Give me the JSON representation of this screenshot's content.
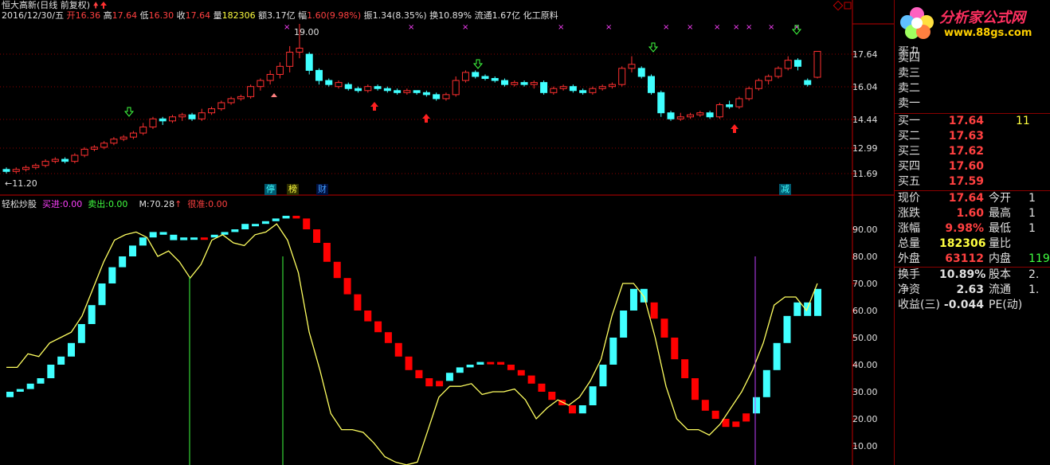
{
  "header": {
    "title": "恒大高新(日线 前复权)",
    "date": "2016/12/30/五",
    "open_label": "开",
    "open": "16.36",
    "high_label": "高",
    "high": "17.64",
    "low_label": "低",
    "low": "16.30",
    "close_label": "收",
    "close": "17.64",
    "volume_label": "量",
    "volume": "182306",
    "amount_label": "额",
    "amount": "3.17亿",
    "change_label": "幅",
    "change": "1.60(9.98%)",
    "amplitude_label": "振",
    "amplitude": "1.34(8.35%)",
    "turnover_label": "换",
    "turnover": "10.89%",
    "float_label": "流通",
    "float": "1.67亿",
    "industry": "化工原料"
  },
  "price_axis": [
    "17.64",
    "16.04",
    "14.44",
    "12.99",
    "11.69"
  ],
  "price_annotations": {
    "high_mark": "19.00",
    "low_mark": "11.20"
  },
  "event_tags": [
    {
      "label": "停",
      "color": "#40ffff"
    },
    {
      "label": "榜",
      "color": "#ffff40"
    },
    {
      "label": "财",
      "color": "#40a0ff"
    },
    {
      "label": "减",
      "color": "#40ffff"
    }
  ],
  "indicator": {
    "name": "轻松炒股",
    "buy_label": "买进:",
    "buy_value": "0.00",
    "sell_label": "卖出:",
    "sell_value": "0.00",
    "m_label": "M:",
    "m_value": "70.28",
    "danger_label": "很准:",
    "danger_value": "0.00",
    "axis": [
      "90.00",
      "80.00",
      "70.00",
      "60.00",
      "50.00",
      "40.00",
      "30.00",
      "20.00",
      "10.00"
    ]
  },
  "chart_data": {
    "type": "candlestick",
    "candles": [
      {
        "o": 11.8,
        "c": 11.7,
        "h": 11.9,
        "l": 11.6
      },
      {
        "o": 11.7,
        "c": 11.8,
        "h": 11.9,
        "l": 11.6
      },
      {
        "o": 11.8,
        "c": 11.9,
        "h": 12.0,
        "l": 11.7
      },
      {
        "o": 11.9,
        "c": 12.0,
        "h": 12.1,
        "l": 11.8
      },
      {
        "o": 12.0,
        "c": 12.2,
        "h": 12.3,
        "l": 11.9
      },
      {
        "o": 12.2,
        "c": 12.3,
        "h": 12.4,
        "l": 12.1
      },
      {
        "o": 12.3,
        "c": 12.2,
        "h": 12.4,
        "l": 12.1
      },
      {
        "o": 12.2,
        "c": 12.5,
        "h": 12.6,
        "l": 12.1
      },
      {
        "o": 12.5,
        "c": 12.8,
        "h": 12.9,
        "l": 12.4
      },
      {
        "o": 12.8,
        "c": 12.9,
        "h": 13.0,
        "l": 12.7
      },
      {
        "o": 12.9,
        "c": 13.1,
        "h": 13.2,
        "l": 12.8
      },
      {
        "o": 13.1,
        "c": 13.3,
        "h": 13.4,
        "l": 13.0
      },
      {
        "o": 13.3,
        "c": 13.4,
        "h": 13.5,
        "l": 13.2
      },
      {
        "o": 13.4,
        "c": 13.6,
        "h": 13.7,
        "l": 13.3
      },
      {
        "o": 13.6,
        "c": 13.9,
        "h": 14.1,
        "l": 13.5
      },
      {
        "o": 13.9,
        "c": 14.3,
        "h": 14.4,
        "l": 13.8
      },
      {
        "o": 14.3,
        "c": 14.2,
        "h": 14.4,
        "l": 14.0
      },
      {
        "o": 14.2,
        "c": 14.4,
        "h": 14.5,
        "l": 14.1
      },
      {
        "o": 14.4,
        "c": 14.5,
        "h": 14.6,
        "l": 14.2
      },
      {
        "o": 14.5,
        "c": 14.3,
        "h": 14.6,
        "l": 14.2
      },
      {
        "o": 14.3,
        "c": 14.6,
        "h": 14.8,
        "l": 14.2
      },
      {
        "o": 14.6,
        "c": 14.8,
        "h": 14.9,
        "l": 14.5
      },
      {
        "o": 14.8,
        "c": 15.1,
        "h": 15.2,
        "l": 14.7
      },
      {
        "o": 15.1,
        "c": 15.3,
        "h": 15.4,
        "l": 15.0
      },
      {
        "o": 15.3,
        "c": 15.4,
        "h": 15.5,
        "l": 15.2
      },
      {
        "o": 15.4,
        "c": 15.9,
        "h": 16.0,
        "l": 15.3
      },
      {
        "o": 15.9,
        "c": 16.2,
        "h": 16.3,
        "l": 15.7
      },
      {
        "o": 16.2,
        "c": 16.5,
        "h": 16.7,
        "l": 16.0
      },
      {
        "o": 16.5,
        "c": 16.9,
        "h": 17.1,
        "l": 16.3
      },
      {
        "o": 16.9,
        "c": 17.6,
        "h": 17.9,
        "l": 16.6
      },
      {
        "o": 17.6,
        "c": 17.8,
        "h": 19.0,
        "l": 17.3
      },
      {
        "o": 17.5,
        "c": 16.7,
        "h": 17.6,
        "l": 16.5
      },
      {
        "o": 16.7,
        "c": 16.2,
        "h": 16.8,
        "l": 16.0
      },
      {
        "o": 16.2,
        "c": 16.0,
        "h": 16.3,
        "l": 15.9
      },
      {
        "o": 15.9,
        "c": 16.1,
        "h": 16.2,
        "l": 15.8
      },
      {
        "o": 16.0,
        "c": 15.8,
        "h": 16.1,
        "l": 15.7
      },
      {
        "o": 15.8,
        "c": 15.7,
        "h": 15.9,
        "l": 15.6
      },
      {
        "o": 15.7,
        "c": 15.9,
        "h": 16.0,
        "l": 15.6
      },
      {
        "o": 15.9,
        "c": 15.8,
        "h": 16.0,
        "l": 15.7
      },
      {
        "o": 15.8,
        "c": 15.7,
        "h": 15.9,
        "l": 15.6
      },
      {
        "o": 15.7,
        "c": 15.6,
        "h": 15.8,
        "l": 15.5
      },
      {
        "o": 15.6,
        "c": 15.7,
        "h": 15.8,
        "l": 15.5
      },
      {
        "o": 15.7,
        "c": 15.6,
        "h": 15.7,
        "l": 15.5
      },
      {
        "o": 15.6,
        "c": 15.5,
        "h": 15.7,
        "l": 15.4
      },
      {
        "o": 15.5,
        "c": 15.3,
        "h": 15.6,
        "l": 15.2
      },
      {
        "o": 15.3,
        "c": 15.5,
        "h": 15.6,
        "l": 15.2
      },
      {
        "o": 15.5,
        "c": 16.2,
        "h": 16.4,
        "l": 15.4
      },
      {
        "o": 16.2,
        "c": 16.6,
        "h": 16.7,
        "l": 16.1
      },
      {
        "o": 16.6,
        "c": 16.4,
        "h": 16.7,
        "l": 16.3
      },
      {
        "o": 16.4,
        "c": 16.3,
        "h": 16.5,
        "l": 16.2
      },
      {
        "o": 16.3,
        "c": 16.2,
        "h": 16.4,
        "l": 16.1
      },
      {
        "o": 16.2,
        "c": 16.0,
        "h": 16.3,
        "l": 15.9
      },
      {
        "o": 16.0,
        "c": 16.1,
        "h": 16.2,
        "l": 15.9
      },
      {
        "o": 16.1,
        "c": 16.0,
        "h": 16.2,
        "l": 15.9
      },
      {
        "o": 16.0,
        "c": 16.1,
        "h": 16.2,
        "l": 15.8
      },
      {
        "o": 16.1,
        "c": 15.6,
        "h": 16.2,
        "l": 15.5
      },
      {
        "o": 15.6,
        "c": 15.8,
        "h": 15.9,
        "l": 15.5
      },
      {
        "o": 15.8,
        "c": 15.9,
        "h": 16.0,
        "l": 15.7
      },
      {
        "o": 15.9,
        "c": 15.7,
        "h": 16.0,
        "l": 15.6
      },
      {
        "o": 15.7,
        "c": 15.6,
        "h": 15.8,
        "l": 15.5
      },
      {
        "o": 15.6,
        "c": 15.8,
        "h": 15.9,
        "l": 15.5
      },
      {
        "o": 15.8,
        "c": 15.9,
        "h": 16.0,
        "l": 15.7
      },
      {
        "o": 15.9,
        "c": 16.0,
        "h": 16.1,
        "l": 15.8
      },
      {
        "o": 16.0,
        "c": 16.8,
        "h": 16.9,
        "l": 15.9
      },
      {
        "o": 16.8,
        "c": 17.0,
        "h": 17.4,
        "l": 16.6
      },
      {
        "o": 16.8,
        "c": 16.4,
        "h": 16.9,
        "l": 16.3
      },
      {
        "o": 16.4,
        "c": 15.6,
        "h": 16.5,
        "l": 15.5
      },
      {
        "o": 15.6,
        "c": 14.6,
        "h": 15.7,
        "l": 14.4
      },
      {
        "o": 14.6,
        "c": 14.3,
        "h": 14.7,
        "l": 14.2
      },
      {
        "o": 14.3,
        "c": 14.4,
        "h": 14.6,
        "l": 14.2
      },
      {
        "o": 14.4,
        "c": 14.5,
        "h": 14.6,
        "l": 14.3
      },
      {
        "o": 14.5,
        "c": 14.6,
        "h": 14.7,
        "l": 14.4
      },
      {
        "o": 14.6,
        "c": 14.4,
        "h": 14.7,
        "l": 14.3
      },
      {
        "o": 14.4,
        "c": 15.0,
        "h": 15.1,
        "l": 14.3
      },
      {
        "o": 15.0,
        "c": 14.9,
        "h": 15.2,
        "l": 14.8
      },
      {
        "o": 14.9,
        "c": 15.3,
        "h": 15.4,
        "l": 14.8
      },
      {
        "o": 15.3,
        "c": 15.8,
        "h": 15.9,
        "l": 15.2
      },
      {
        "o": 15.8,
        "c": 16.2,
        "h": 16.3,
        "l": 15.7
      },
      {
        "o": 16.2,
        "c": 16.4,
        "h": 16.5,
        "l": 16.0
      },
      {
        "o": 16.4,
        "c": 16.8,
        "h": 16.9,
        "l": 16.3
      },
      {
        "o": 16.8,
        "c": 17.2,
        "h": 17.4,
        "l": 16.7
      },
      {
        "o": 17.2,
        "c": 16.9,
        "h": 17.3,
        "l": 16.7
      },
      {
        "o": 16.2,
        "c": 16.0,
        "h": 16.3,
        "l": 15.9
      },
      {
        "o": 16.36,
        "c": 17.64,
        "h": 17.64,
        "l": 16.3
      }
    ],
    "bars": [
      {
        "v": 30,
        "c": "cyan"
      },
      {
        "v": 31,
        "c": "cyan"
      },
      {
        "v": 33,
        "c": "cyan"
      },
      {
        "v": 35,
        "c": "cyan"
      },
      {
        "v": 40,
        "c": "cyan"
      },
      {
        "v": 43,
        "c": "cyan"
      },
      {
        "v": 48,
        "c": "cyan"
      },
      {
        "v": 55,
        "c": "cyan"
      },
      {
        "v": 62,
        "c": "cyan"
      },
      {
        "v": 70,
        "c": "cyan"
      },
      {
        "v": 76,
        "c": "cyan"
      },
      {
        "v": 80,
        "c": "cyan"
      },
      {
        "v": 84,
        "c": "cyan"
      },
      {
        "v": 87,
        "c": "cyan"
      },
      {
        "v": 89,
        "c": "cyan"
      },
      {
        "v": 88,
        "c": "cyan"
      },
      {
        "v": 86,
        "c": "cyan"
      },
      {
        "v": 87,
        "c": "cyan"
      },
      {
        "v": 87,
        "c": "cyan"
      },
      {
        "v": 87,
        "c": "red"
      },
      {
        "v": 88,
        "c": "cyan"
      },
      {
        "v": 89,
        "c": "cyan"
      },
      {
        "v": 90,
        "c": "cyan"
      },
      {
        "v": 92,
        "c": "cyan"
      },
      {
        "v": 92,
        "c": "cyan"
      },
      {
        "v": 93,
        "c": "cyan"
      },
      {
        "v": 94,
        "c": "cyan"
      },
      {
        "v": 95,
        "c": "cyan"
      },
      {
        "v": 94,
        "c": "red"
      },
      {
        "v": 90,
        "c": "red"
      },
      {
        "v": 85,
        "c": "red"
      },
      {
        "v": 78,
        "c": "red"
      },
      {
        "v": 72,
        "c": "red"
      },
      {
        "v": 66,
        "c": "red"
      },
      {
        "v": 60,
        "c": "red"
      },
      {
        "v": 56,
        "c": "red"
      },
      {
        "v": 52,
        "c": "red"
      },
      {
        "v": 48,
        "c": "red"
      },
      {
        "v": 43,
        "c": "red"
      },
      {
        "v": 38,
        "c": "red"
      },
      {
        "v": 35,
        "c": "red"
      },
      {
        "v": 32,
        "c": "red"
      },
      {
        "v": 34,
        "c": "red"
      },
      {
        "v": 37,
        "c": "cyan"
      },
      {
        "v": 39,
        "c": "cyan"
      },
      {
        "v": 40,
        "c": "cyan"
      },
      {
        "v": 41,
        "c": "cyan"
      },
      {
        "v": 41,
        "c": "red"
      },
      {
        "v": 40,
        "c": "red"
      },
      {
        "v": 38,
        "c": "red"
      },
      {
        "v": 36,
        "c": "red"
      },
      {
        "v": 33,
        "c": "red"
      },
      {
        "v": 30,
        "c": "red"
      },
      {
        "v": 27,
        "c": "red"
      },
      {
        "v": 25,
        "c": "red"
      },
      {
        "v": 22,
        "c": "red"
      },
      {
        "v": 25,
        "c": "cyan"
      },
      {
        "v": 32,
        "c": "cyan"
      },
      {
        "v": 40,
        "c": "cyan"
      },
      {
        "v": 50,
        "c": "cyan"
      },
      {
        "v": 60,
        "c": "cyan"
      },
      {
        "v": 68,
        "c": "cyan"
      },
      {
        "v": 63,
        "c": "cyan"
      },
      {
        "v": 57,
        "c": "red"
      },
      {
        "v": 50,
        "c": "red"
      },
      {
        "v": 42,
        "c": "red"
      },
      {
        "v": 35,
        "c": "red"
      },
      {
        "v": 27,
        "c": "red"
      },
      {
        "v": 23,
        "c": "red"
      },
      {
        "v": 20,
        "c": "red"
      },
      {
        "v": 17,
        "c": "red"
      },
      {
        "v": 19,
        "c": "red"
      },
      {
        "v": 22,
        "c": "red"
      },
      {
        "v": 28,
        "c": "cyan"
      },
      {
        "v": 38,
        "c": "cyan"
      },
      {
        "v": 48,
        "c": "cyan"
      },
      {
        "v": 58,
        "c": "cyan"
      },
      {
        "v": 63,
        "c": "cyan"
      },
      {
        "v": 58,
        "c": "cyan"
      },
      {
        "v": 68,
        "c": "cyan"
      }
    ],
    "line": [
      39,
      39,
      44,
      43,
      48,
      50,
      52,
      58,
      68,
      78,
      86,
      88,
      89,
      87,
      80,
      82,
      78,
      72,
      77,
      86,
      88,
      85,
      84,
      88,
      89,
      92,
      86,
      74,
      52,
      38,
      22,
      16,
      16,
      15,
      11,
      6,
      4,
      3,
      4,
      16,
      28,
      32,
      32,
      33,
      29,
      30,
      30,
      31,
      27,
      20,
      24,
      27,
      25,
      28,
      34,
      42,
      58,
      70,
      70,
      65,
      50,
      32,
      20,
      16,
      16,
      14,
      18,
      24,
      30,
      38,
      48,
      62,
      65,
      65,
      60,
      70
    ],
    "ylim_price": [
      11.2,
      19.0
    ],
    "ylim_ind": [
      0,
      100
    ]
  },
  "order_book": {
    "sells": [
      {
        "label": "卖五",
        "price": ""
      },
      {
        "label": "卖四",
        "price": ""
      },
      {
        "label": "卖三",
        "price": ""
      },
      {
        "label": "卖二",
        "price": ""
      },
      {
        "label": "卖一",
        "price": ""
      }
    ],
    "buys": [
      {
        "label": "买一",
        "price": "17.64",
        "vol": "11"
      },
      {
        "label": "买二",
        "price": "17.63",
        "vol": ""
      },
      {
        "label": "买三",
        "price": "17.62",
        "vol": ""
      },
      {
        "label": "买四",
        "price": "17.60",
        "vol": ""
      },
      {
        "label": "买五",
        "price": "17.59",
        "vol": ""
      }
    ]
  },
  "stats": [
    {
      "l1": "现价",
      "v1": "17.64",
      "c1": "#ff4040",
      "l2": "今开",
      "v2": "1"
    },
    {
      "l1": "涨跌",
      "v1": "1.60",
      "c1": "#ff4040",
      "l2": "最高",
      "v2": "1"
    },
    {
      "l1": "涨幅",
      "v1": "9.98%",
      "c1": "#ff4040",
      "l2": "最低",
      "v2": "1"
    },
    {
      "l1": "总量",
      "v1": "182306",
      "c1": "#ffff40",
      "l2": "量比",
      "v2": ""
    },
    {
      "l1": "外盘",
      "v1": "63112",
      "c1": "#ff4040",
      "l2": "内盘",
      "v2": "119"
    },
    {
      "l1": "换手",
      "v1": "10.89%",
      "c1": "#e0e0e0",
      "l2": "股本",
      "v2": "2."
    },
    {
      "l1": "净资",
      "v1": "2.63",
      "c1": "#e0e0e0",
      "l2": "流通",
      "v2": "1."
    },
    {
      "l1": "收益(三)",
      "v1": "-0.044",
      "c1": "#e0e0e0",
      "l2": "PE(动)",
      "v2": ""
    }
  ],
  "logo": {
    "text": "分析家公式网",
    "url": "www.88gs.com"
  },
  "colors": {
    "up": "#ff3030",
    "down": "#40ffff",
    "line": "#ffff60",
    "grid": "#8b0000",
    "axis": "#c00000"
  }
}
